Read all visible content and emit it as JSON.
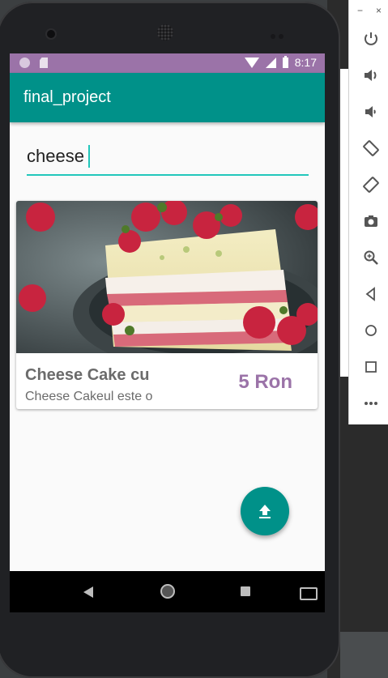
{
  "status_bar": {
    "time": "8:17"
  },
  "app_bar": {
    "title": "final_project"
  },
  "search": {
    "value": "cheese"
  },
  "card": {
    "title": "Cheese Cake cu",
    "description": "Cheese Cakeul este o",
    "price": "5 Ron"
  },
  "fab": {
    "icon": "upload-icon"
  },
  "emulator_toolbar": {
    "minimize": "−",
    "close": "×",
    "items": [
      "power-icon",
      "volume-up-icon",
      "volume-down-icon",
      "rotate-left-icon",
      "rotate-right-icon",
      "camera-icon",
      "zoom-icon",
      "back-icon",
      "home-icon",
      "overview-icon",
      "more-icon"
    ]
  },
  "colors": {
    "primary": "#009189",
    "accent": "#22c7bb",
    "status_bar": "#9b73a8",
    "price": "#9b73a8"
  }
}
